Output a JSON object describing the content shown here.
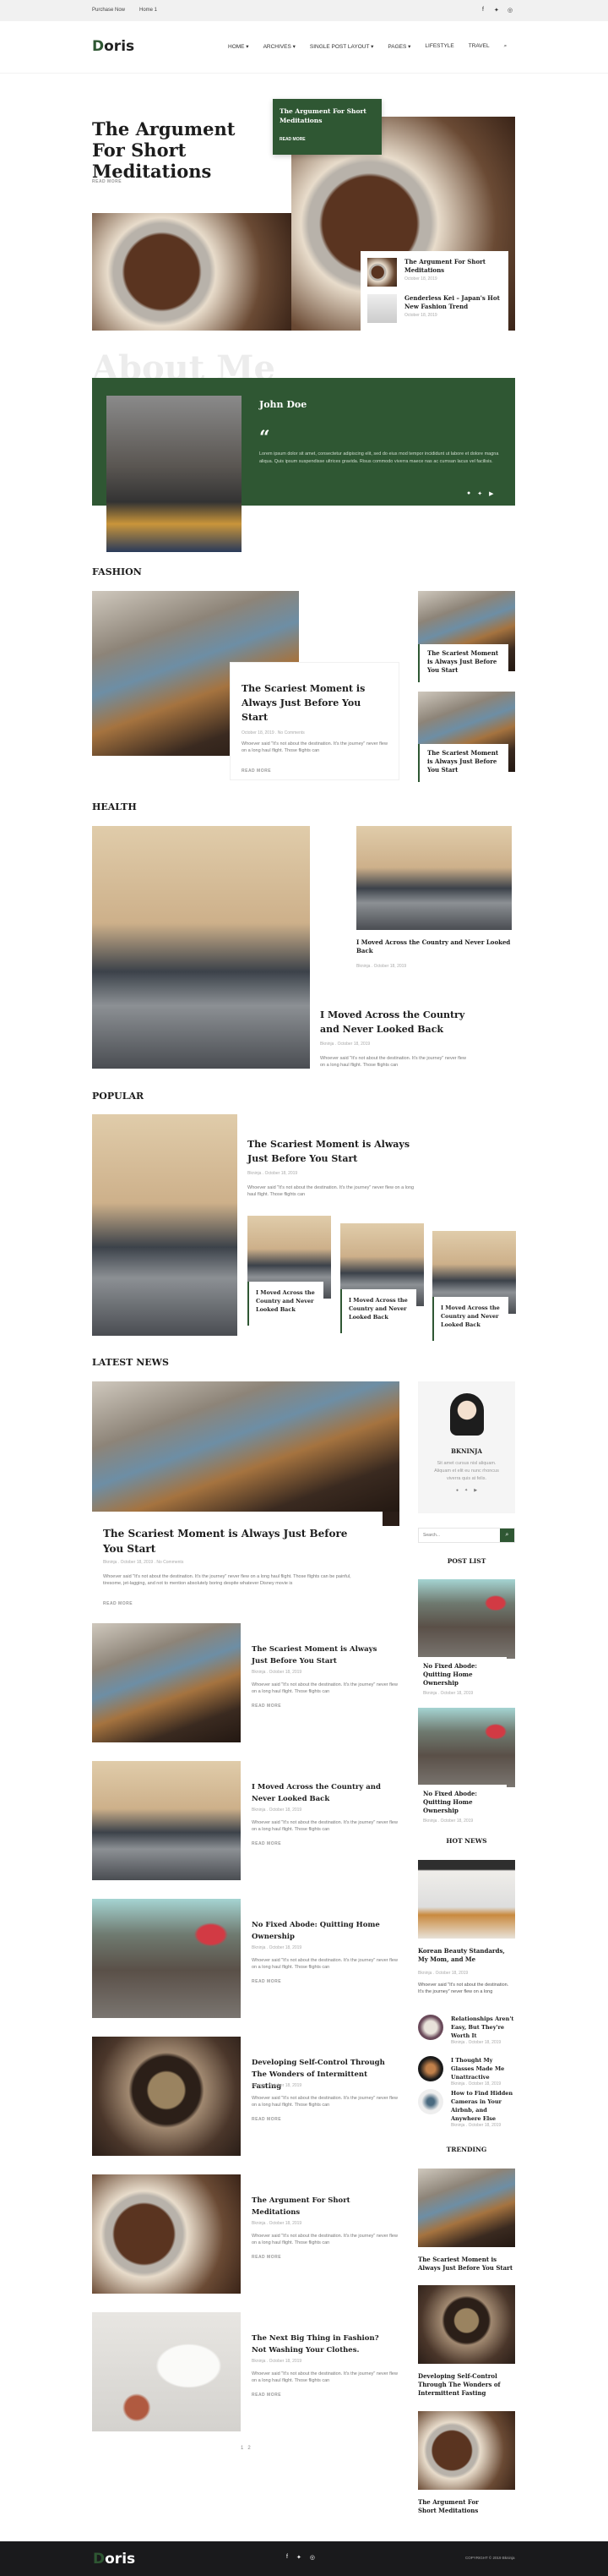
{
  "topbar": {
    "links": [
      "Purchase Now",
      "Home 1"
    ],
    "social": [
      "facebook-icon",
      "twitter-icon",
      "instagram-icon"
    ]
  },
  "header": {
    "logo": "Doris",
    "nav": [
      "HOME",
      "ARCHIVES",
      "SINGLE POST LAYOUT",
      "PAGES",
      "LIFESTYLE",
      "TRAVEL"
    ],
    "nav_dropdown": [
      true,
      true,
      true,
      true,
      false,
      false
    ]
  },
  "colors": {
    "brand": "#2f5733",
    "footer": "#1a1a1c"
  },
  "hero": {
    "title": "The Argument For Short Meditations",
    "read_more": "READ MORE",
    "featured_title": "The Argument For Short Meditations",
    "featured_read_more": "READ MORE",
    "side_items": [
      {
        "title": "The Argument For Short Meditations",
        "date": "October 18, 2019"
      },
      {
        "title": "Genderless Kei – Japan's Hot New Fashion Trend",
        "date": "October 18, 2019"
      }
    ]
  },
  "about": {
    "watermark": "About Me",
    "name": "John Doe",
    "quote_mark": "“",
    "text": "Lorem ipsum dolor sit amet, consectetur adipiscing elit, sed do eius mod tempor incididunt ut labore et dolore magna aliqua. Quis ipsum suspendisse ultrices gravida. Risus commodo viverra maece nas ac cumsan lacus vel facilisis.",
    "social": [
      "facebook-icon",
      "twitter-icon",
      "youtube-icon"
    ]
  },
  "fashion": {
    "heading": "FASHION",
    "main": {
      "title": "The Scariest Moment is Always Just Before You Start",
      "meta": "October 18, 2019 . No Comments",
      "excerpt": "Whoever said \"It's not about the destination. It's the journey\" never flew on a long haul flight. Those flights can",
      "read_more": "READ MORE"
    },
    "side": [
      {
        "title": "The Scariest Moment is Always Just Before You Start"
      },
      {
        "title": "The Scariest Moment is Always Just Before You Start"
      }
    ]
  },
  "health": {
    "heading": "HEALTH",
    "side": {
      "title": "I Moved Across the Country and Never Looked Back",
      "meta": "Bkninja . October 18, 2019"
    },
    "main": {
      "title": "I Moved Across the Country and Never Looked Back",
      "meta": "Bkninja . October 18, 2019",
      "excerpt": "Whoever said \"It's not about the destination. It's the journey\" never flew on a long haul flight. Those flights can"
    }
  },
  "popular": {
    "heading": "POPULAR",
    "main": {
      "title": "The Scariest Moment is Always Just Before You Start",
      "meta": "Bkninja . October 18, 2019",
      "excerpt": "Whoever said \"It's not about the destination. It's the journey\" never flew on a long haul flight. Those flights can"
    },
    "cards": [
      {
        "title": "I Moved Across the Country and Never Looked Back"
      },
      {
        "title": "I Moved Across the Country and Never Looked Back"
      },
      {
        "title": "I Moved Across the Country and Never Looked Back"
      }
    ]
  },
  "latest": {
    "heading": "LATEST NEWS",
    "main": {
      "title": "The Scariest Moment is Always Just Before You Start",
      "meta": "Bkninja . October 18, 2019 . No Comments",
      "excerpt": "Whoever said \"It's not about the destination. It's the journey\" never flew on a long haul flight. Those flights can be painful, tiresome, jet-lagging, and not to mention absolutely boring despite whatever Disney movie is",
      "read_more": "READ MORE"
    },
    "items": [
      {
        "title": "The Scariest Moment is Always Just Before You Start",
        "meta": "Bkninja . October 18, 2019",
        "excerpt": "Whoever said \"It's not about the destination. It's the journey\" never flew on a long haul flight. Those flights can",
        "read_more": "READ MORE"
      },
      {
        "title": "I Moved Across the Country and Never Looked Back",
        "meta": "Bkninja . October 18, 2019",
        "excerpt": "Whoever said \"It's not about the destination. It's the journey\" never flew on a long haul flight. Those flights can",
        "read_more": "READ MORE"
      },
      {
        "title": "No Fixed Abode: Quitting Home Ownership",
        "meta": "Bkninja . October 18, 2019",
        "excerpt": "Whoever said \"It's not about the destination. It's the journey\" never flew on a long haul flight. Those flights can",
        "read_more": "READ MORE"
      },
      {
        "title": "Developing Self-Control Through The Wonders of Intermittent Fasting",
        "meta": "Bkninja . October 18, 2019",
        "excerpt": "Whoever said \"It's not about the destination. It's the journey\" never flew on a long haul flight. Those flights can",
        "read_more": "READ MORE"
      },
      {
        "title": "The Argument For Short Meditations",
        "meta": "Bkninja . October 18, 2019",
        "excerpt": "Whoever said \"It's not about the destination. It's the journey\" never flew on a long haul flight. Those flights can",
        "read_more": "READ MORE"
      },
      {
        "title": "The Next Big Thing in Fashion? Not Washing Your Clothes.",
        "meta": "Bkninja . October 18, 2019",
        "excerpt": "Whoever said \"It's not about the destination. It's the journey\" never flew on a long haul flight. Those flights can",
        "read_more": "READ MORE"
      }
    ],
    "pagination": [
      "1",
      "2"
    ]
  },
  "sidebar": {
    "profile": {
      "name": "BKNINJA",
      "bio": "Sit amet cursus nisl aliquam. Aliquam et elit eu nunc rhoncus viverra quis at felis.",
      "social": [
        "facebook-icon",
        "twitter-icon",
        "youtube-icon"
      ]
    },
    "search": {
      "placeholder": "Search..."
    },
    "post_list": {
      "heading": "POST LIST",
      "items": [
        {
          "title": "No Fixed Abode: Quitting Home Ownership",
          "meta": "Bkninja . October 18, 2019"
        },
        {
          "title": "No Fixed Abode: Quitting Home Ownership",
          "meta": "Bkninja . October 18, 2019"
        }
      ]
    },
    "hot_news": {
      "heading": "HOT NEWS",
      "main": {
        "title": "Korean Beauty Standards, My Mom, and Me",
        "meta": "Bkninja . October 18, 2019",
        "excerpt": "Whoever said \"It's not about the destination. It's the journey\" never flew on a long"
      },
      "items": [
        {
          "title": "Relationships Aren't Easy, But They're Worth It",
          "meta": "Bkninja . October 18, 2019"
        },
        {
          "title": "I Thought My Glasses Made Me Unattractive",
          "meta": "Bkninja . October 18, 2019"
        },
        {
          "title": "How to Find Hidden Cameras in Your Airbnb, and Anywhere Else",
          "meta": "Bkninja . October 18, 2019"
        }
      ]
    },
    "trending": {
      "heading": "TRENDING",
      "items": [
        {
          "title": "The Scariest Moment is Always Just Before You Start"
        },
        {
          "title": "Developing Self-Control Through The Wonders of Intermittent Fasting"
        },
        {
          "title": "The Argument For Short Meditations"
        }
      ]
    }
  },
  "footer": {
    "logo": "Doris",
    "social": [
      "facebook-icon",
      "twitter-icon",
      "instagram-icon"
    ],
    "copyright": "COPYRIGHT © 2019 Bkninja"
  }
}
